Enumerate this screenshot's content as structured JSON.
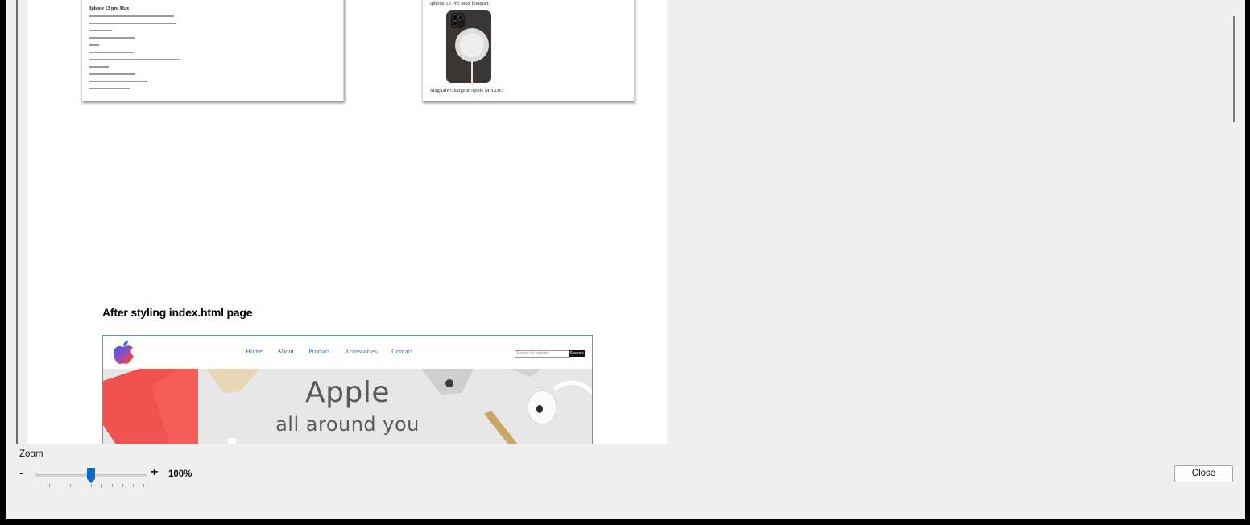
{
  "document": {
    "thumb_left_title": "Iphone 13 pro Max",
    "thumb_right_caption_top": "iphone 13 Pro Max bouquet",
    "thumb_right_caption_bottom": "MagSafe Chargeur Apple MHXH3",
    "heading": "After styling index.html page"
  },
  "screenshot_preview": {
    "nav_links": [
      "Home",
      "About",
      "Product",
      "Accessories",
      "Contact"
    ],
    "search_placeholder": "Search in website",
    "search_button": "Search",
    "hero_title": "Apple",
    "hero_subtitle": "all around you"
  },
  "zoom": {
    "label": "Zoom",
    "minus": "-",
    "plus": "+",
    "value": "100%",
    "slider_fraction": 0.48
  },
  "footer": {
    "close_label": "Close"
  },
  "colors": {
    "accent": "#0a6ad0",
    "nav_link": "#3a66b0"
  }
}
